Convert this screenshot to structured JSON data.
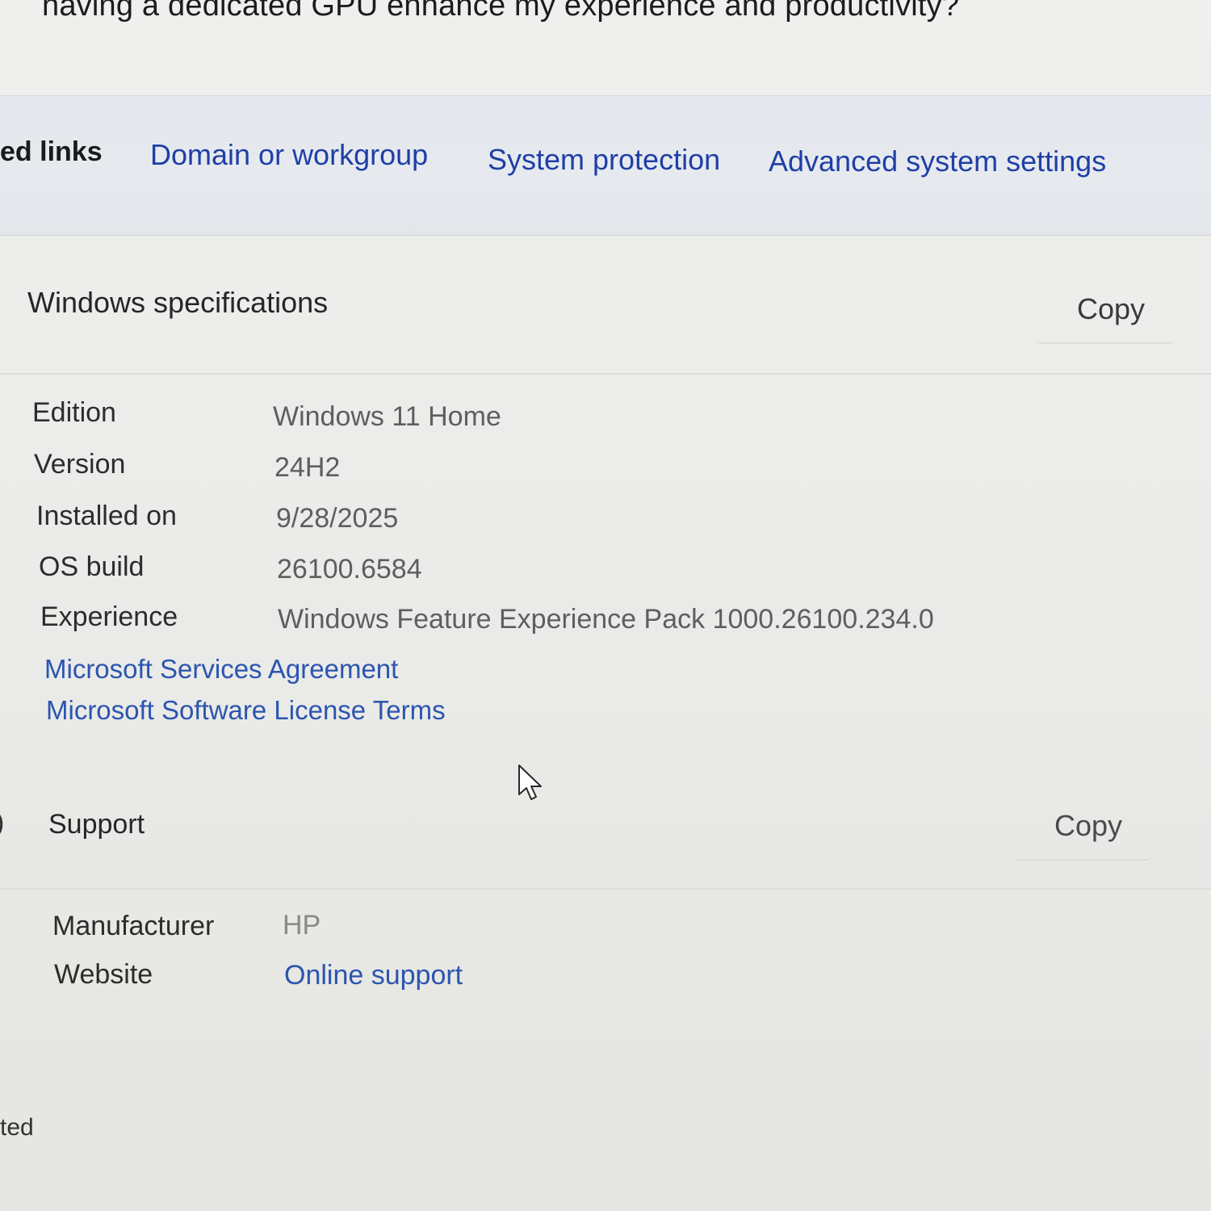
{
  "header": {
    "question": "having a dedicated GPU enhance my experience and productivity?"
  },
  "related_links": {
    "label": "ed links",
    "links": [
      "Domain or workgroup",
      "System protection",
      "Advanced system settings"
    ]
  },
  "windows_specs": {
    "title": "Windows specifications",
    "copy_label": "Copy",
    "rows": [
      {
        "label": "Edition",
        "value": "Windows 11 Home"
      },
      {
        "label": "Version",
        "value": "24H2"
      },
      {
        "label": "Installed on",
        "value": "9/28/2025"
      },
      {
        "label": "OS build",
        "value": "26100.6584"
      },
      {
        "label": "Experience",
        "value": "Windows Feature Experience Pack 1000.26100.234.0"
      }
    ],
    "links": [
      "Microsoft Services Agreement",
      "Microsoft Software License Terms"
    ]
  },
  "support": {
    "icon_glyph": ")",
    "title": "Support",
    "copy_label": "Copy",
    "rows": [
      {
        "label": "Manufacturer",
        "value": "HP"
      },
      {
        "label": "Website",
        "value": "Online support"
      }
    ]
  },
  "footer": {
    "partial_text": "ted"
  },
  "icons": {
    "cursor": "mouse-pointer-icon"
  },
  "colors": {
    "link": "#1f3fa6",
    "value_text": "#5e5e5e",
    "label_text": "#2c2c2c"
  }
}
